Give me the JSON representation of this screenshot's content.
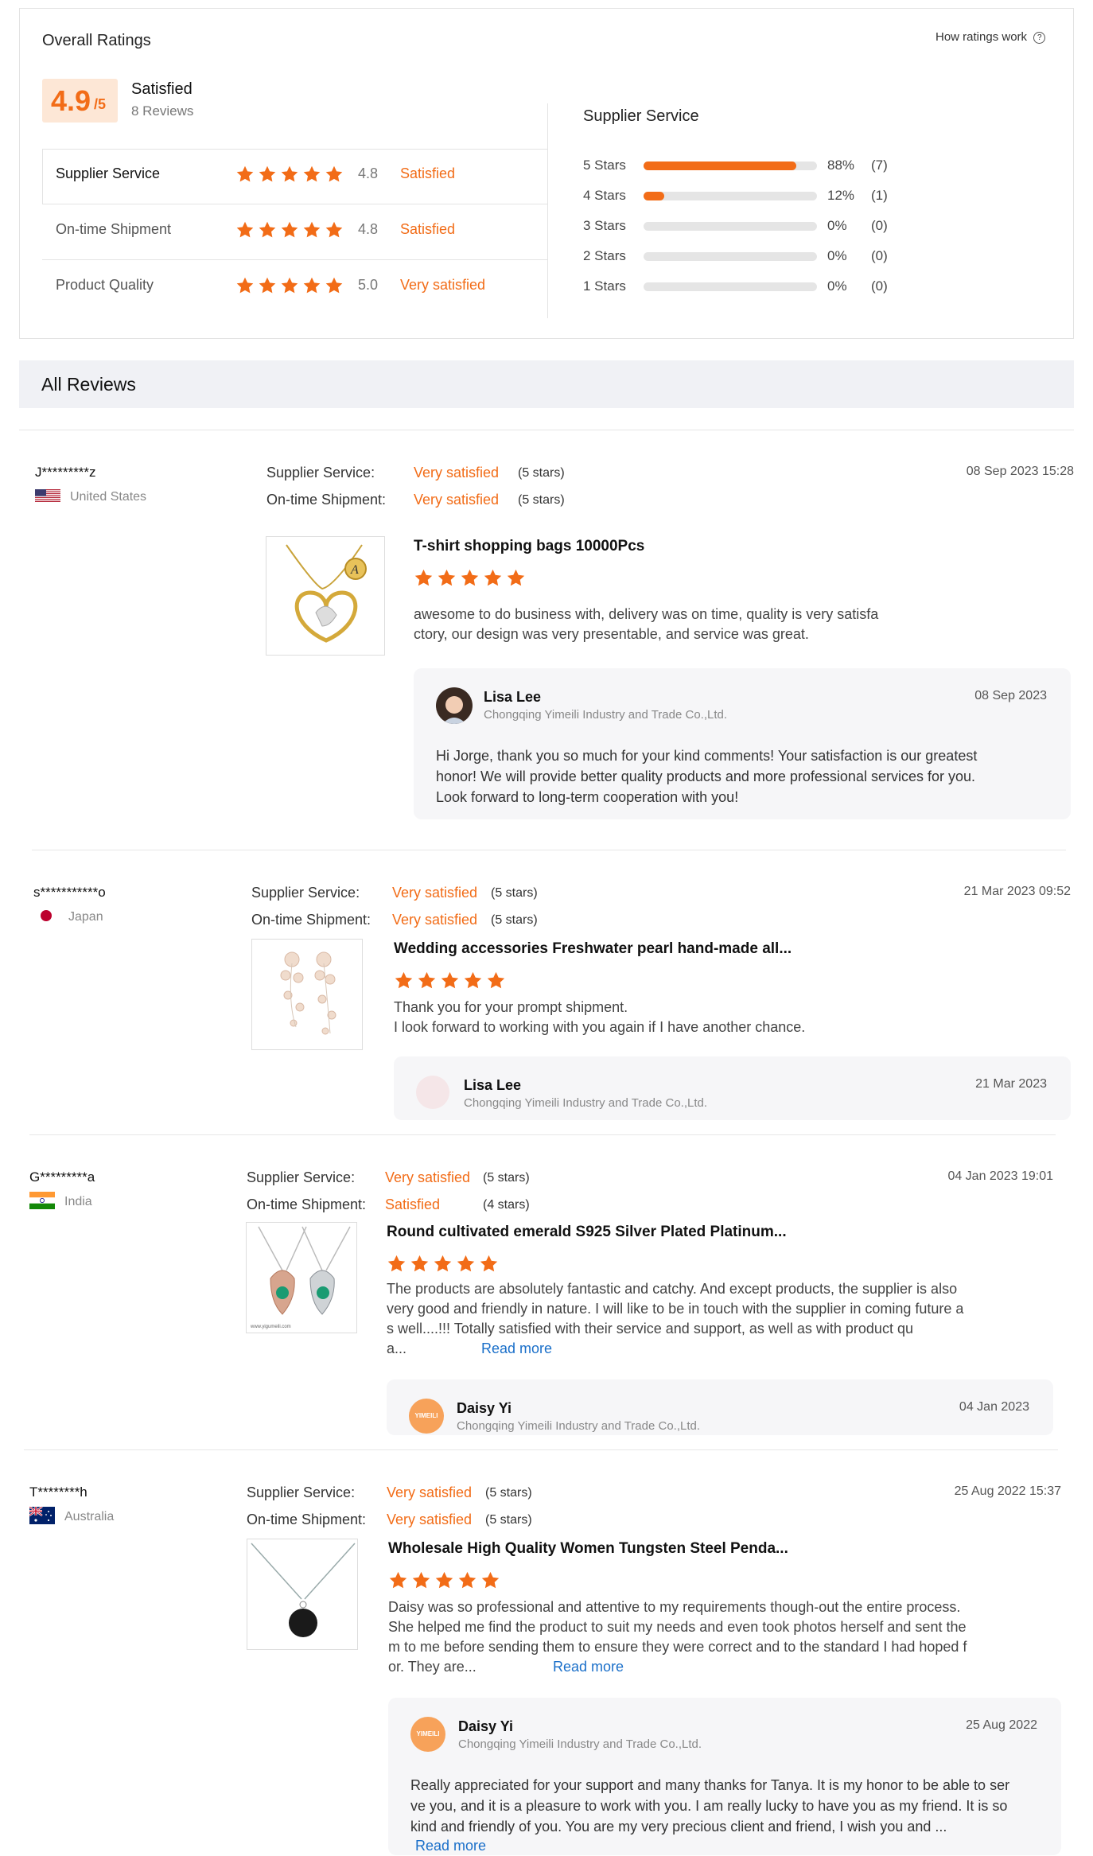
{
  "overall": {
    "title": "Overall Ratings",
    "how_link": "How ratings work",
    "score": "4.9",
    "score_suffix": "/5",
    "summary": "Satisfied",
    "count": "8 Reviews",
    "categories": [
      {
        "label": "Supplier Service",
        "score": "4.8",
        "text": "Satisfied",
        "stars": 5
      },
      {
        "label": "On-time Shipment",
        "score": "4.8",
        "text": "Satisfied",
        "stars": 5
      },
      {
        "label": "Product Quality",
        "score": "5.0",
        "text": "Very satisfied",
        "stars": 5
      }
    ],
    "breakdown_title": "Supplier Service",
    "breakdown": [
      {
        "label": "5 Stars",
        "pct": "88%",
        "count": "(7)",
        "fill": 0.88
      },
      {
        "label": "4 Stars",
        "pct": "12%",
        "count": "(1)",
        "fill": 0.12
      },
      {
        "label": "3 Stars",
        "pct": "0%",
        "count": "(0)",
        "fill": 0
      },
      {
        "label": "2 Stars",
        "pct": "0%",
        "count": "(0)",
        "fill": 0
      },
      {
        "label": "1 Stars",
        "pct": "0%",
        "count": "(0)",
        "fill": 0
      }
    ]
  },
  "all_reviews_title": "All Reviews",
  "labels": {
    "supplier_service": "Supplier Service:",
    "ontime_shipment": "On-time Shipment:",
    "read_more": "Read more"
  },
  "reviews": [
    {
      "user": "J*********z",
      "country": "United States",
      "ss_text": "Very satisfied",
      "ss_stars": "(5 stars)",
      "os_text": "Very satisfied",
      "os_stars": "(5 stars)",
      "date": "08 Sep 2023 15:28",
      "product": "T-shirt shopping bags 10000Pcs",
      "body": [
        "awesome to do business with, delivery was on time, quality is very satisfa",
        "ctory, our design was very presentable, and service was great."
      ],
      "reply": {
        "name": "Lisa Lee",
        "company": "Chongqing Yimeili Industry and Trade Co.,Ltd.",
        "date": "08 Sep 2023",
        "body": [
          "Hi Jorge, thank you so much for your kind comments! Your satisfaction is our greatest",
          "honor! We will provide better quality products and more professional services for you.",
          "Look forward to long-term cooperation with you!"
        ]
      }
    },
    {
      "user": "s***********o",
      "country": "Japan",
      "ss_text": "Very satisfied",
      "ss_stars": "(5 stars)",
      "os_text": "Very satisfied",
      "os_stars": "(5 stars)",
      "date": "21 Mar 2023 09:52",
      "product": "Wedding accessories Freshwater pearl hand-made all...",
      "body": [
        "Thank you for your prompt shipment.",
        "I look forward to working with you again if I have another chance."
      ],
      "reply": {
        "name": "Lisa Lee",
        "company": "Chongqing Yimeili Industry and Trade Co.,Ltd.",
        "date": "21 Mar 2023"
      }
    },
    {
      "user": "G*********a",
      "country": "India",
      "ss_text": "Very satisfied",
      "ss_stars": "(5 stars)",
      "os_text": "Satisfied",
      "os_stars": "(4 stars)",
      "date": "04 Jan 2023 19:01",
      "product": "Round cultivated emerald S925 Silver Plated Platinum...",
      "body": [
        "The products are absolutely fantastic and catchy. And except products, the supplier is also",
        "very good and friendly in nature. I will like to be in touch with the supplier in coming future a",
        "s well....!!! Totally satisfied with their service and support, as well as with product qu",
        "a..."
      ],
      "reply": {
        "name": "Daisy Yi",
        "company": "Chongqing Yimeili Industry and Trade Co.,Ltd.",
        "date": "04 Jan 2023",
        "logo": "YIMEILI"
      }
    },
    {
      "user": "T********h",
      "country": "Australia",
      "ss_text": "Very satisfied",
      "ss_stars": "(5 stars)",
      "os_text": "Very satisfied",
      "os_stars": "(5 stars)",
      "date": "25 Aug 2022 15:37",
      "product": "Wholesale High Quality Women Tungsten Steel Penda...",
      "body": [
        "Daisy was so professional and attentive to my requirements though-out the entire process.",
        "She helped me find the product to suit my needs and even took photos herself and sent the",
        "m to me before sending them to ensure they were correct and to the standard I had hoped f",
        "or. They are..."
      ],
      "reply": {
        "name": "Daisy Yi",
        "company": "Chongqing Yimeili Industry and Trade Co.,Ltd.",
        "date": "25 Aug 2022",
        "logo": "YIMEILI",
        "body": [
          "Really appreciated for your support and many thanks for Tanya. It is my honor to be able to ser",
          "ve you, and it is a pleasure to work with you. I am really lucky to have you as my friend. It is so",
          "kind and friendly of you. You are my very precious client and friend, I wish you and ..."
        ]
      }
    }
  ],
  "colors": {
    "accent": "#f26c17",
    "link": "#1a6fc9",
    "star_empty": "#e5e5e5"
  },
  "watermark_caption": "www.yigumeili.com"
}
